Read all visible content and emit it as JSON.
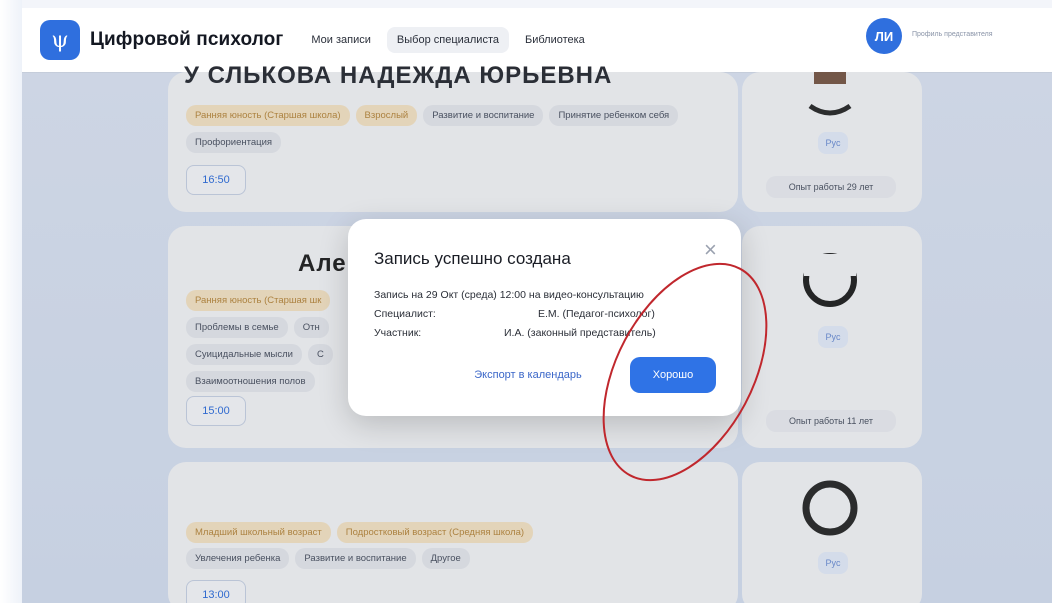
{
  "header": {
    "logo_glyph": "ψ",
    "brand": "Цифровой психолог",
    "nav": [
      "Мои записи",
      "Выбор специалиста",
      "Библиотека"
    ],
    "active_nav": "Выбор специалиста",
    "avatar_initials": "ЛИ",
    "profile_link": "Профиль представителя"
  },
  "cards": [
    {
      "name_partial": "У СЛЬКОВА НАДЕЖДА ЮРЬЕВНА",
      "tags_age": [
        "Ранняя юность (Старшая школа)",
        "Взрослый"
      ],
      "tags": [
        "Развитие и воспитание",
        "Принятие ребенком себя",
        "Профориентация"
      ],
      "time": "16:50",
      "lang": "Рус",
      "experience": "Опыт работы 29 лет"
    },
    {
      "name_partial": "Але",
      "tags_age": [
        "Ранняя юность (Старшая шк"
      ],
      "tags": [
        "Проблемы в семье",
        "Отн",
        "Суицидальные мысли",
        "С",
        "Взаимоотношения полов"
      ],
      "time": "15:00",
      "lang": "Рус",
      "experience": "Опыт работы 11 лет"
    },
    {
      "name_partial": "",
      "tags_age": [
        "Младший школьный возраст",
        "Подростковый возраст (Средняя школа)"
      ],
      "tags": [
        "Увлечения ребенка",
        "Развитие и воспитание",
        "Другое"
      ],
      "time": "13:00",
      "lang": "Рус",
      "experience": ""
    }
  ],
  "modal": {
    "title": "Запись успешно создана",
    "close_glyph": "×",
    "line1": "Запись на 29 Окт (среда) 12:00 на видео-консультацию",
    "specialist_label": "Специалист:",
    "specialist_value": "Е.М. (Педагог-психолог)",
    "participant_label": "Участник:",
    "participant_value": "И.А. (законный представитель)",
    "export_button": "Экспорт в календарь",
    "ok_button": "Хорошо"
  },
  "colors": {
    "accent": "#2f73e6",
    "age_tag_bg": "#f7e5c6",
    "annotation_red": "#c0272d"
  },
  "icons": [
    "psi-logo-icon",
    "close-icon",
    "avatar-photo"
  ]
}
